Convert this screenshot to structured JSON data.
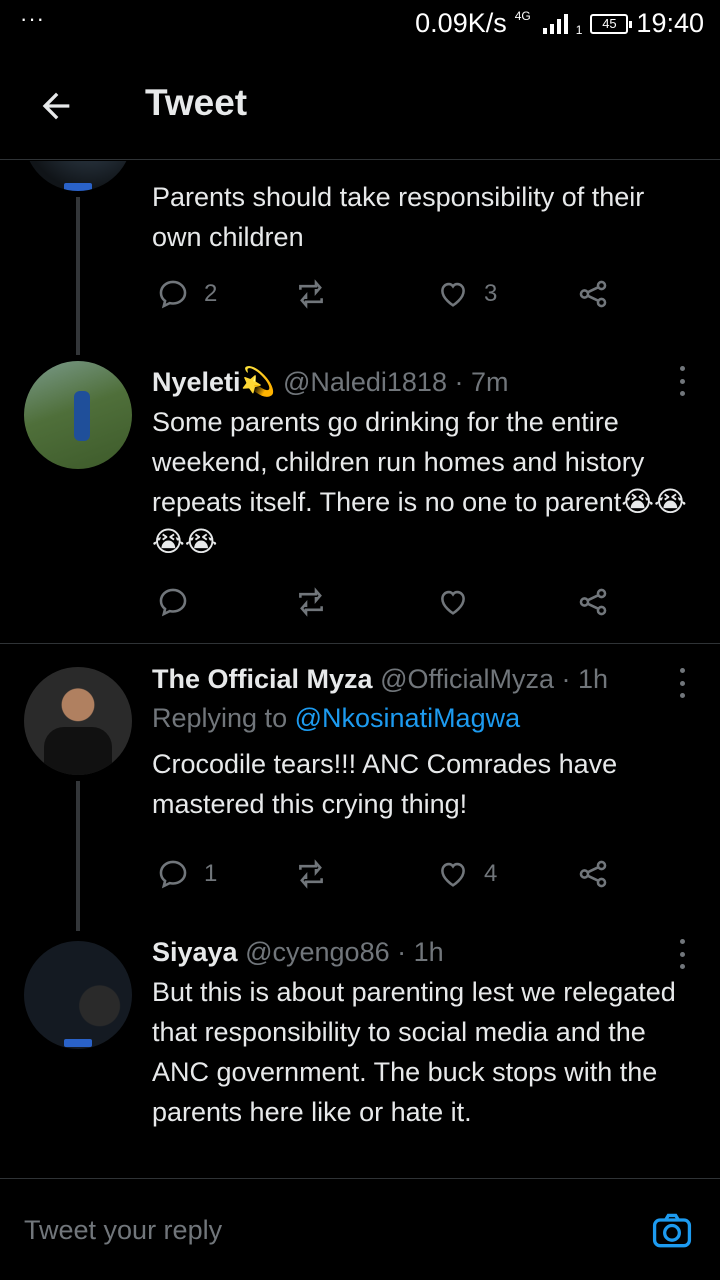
{
  "status_bar": {
    "dots": "···",
    "net_speed": "0.09K/s",
    "network": "4G",
    "sim": "1",
    "battery": "45",
    "time": "19:40"
  },
  "header": {
    "title": "Tweet"
  },
  "tweets": [
    {
      "text": "Parents should take responsibility of their own children",
      "replies": "2",
      "retweets": "",
      "likes": "3"
    },
    {
      "name": "Nyeleti",
      "name_emoji": "💫",
      "handle": "@Naledi1818",
      "time": "· 7m",
      "text": "Some parents go drinking for the entire weekend, children run homes and history repeats itself. There is no one to parent",
      "emojis": "😭😭😭😭",
      "replies": "",
      "retweets": "",
      "likes": ""
    },
    {
      "name": "The Official Myza",
      "handle": "@OfficialMyza",
      "time": "· 1h",
      "replying_label": "Replying to",
      "replying_to": "@NkosinatiMagwa",
      "text": "Crocodile tears!!! ANC Comrades have mastered this crying thing!",
      "replies": "1",
      "retweets": "",
      "likes": "4"
    },
    {
      "name": "Siyaya",
      "handle": "@cyengo86",
      "time": "· 1h",
      "text": "But this is about parenting lest we relegated that responsibility to social media and the ANC government. The buck stops with the  parents here like or hate it."
    }
  ],
  "reply_bar": {
    "placeholder": "Tweet your reply"
  },
  "colors": {
    "background": "#000000",
    "accent": "#1d9bf0",
    "muted": "#71767b",
    "text": "#e7e9ea"
  }
}
